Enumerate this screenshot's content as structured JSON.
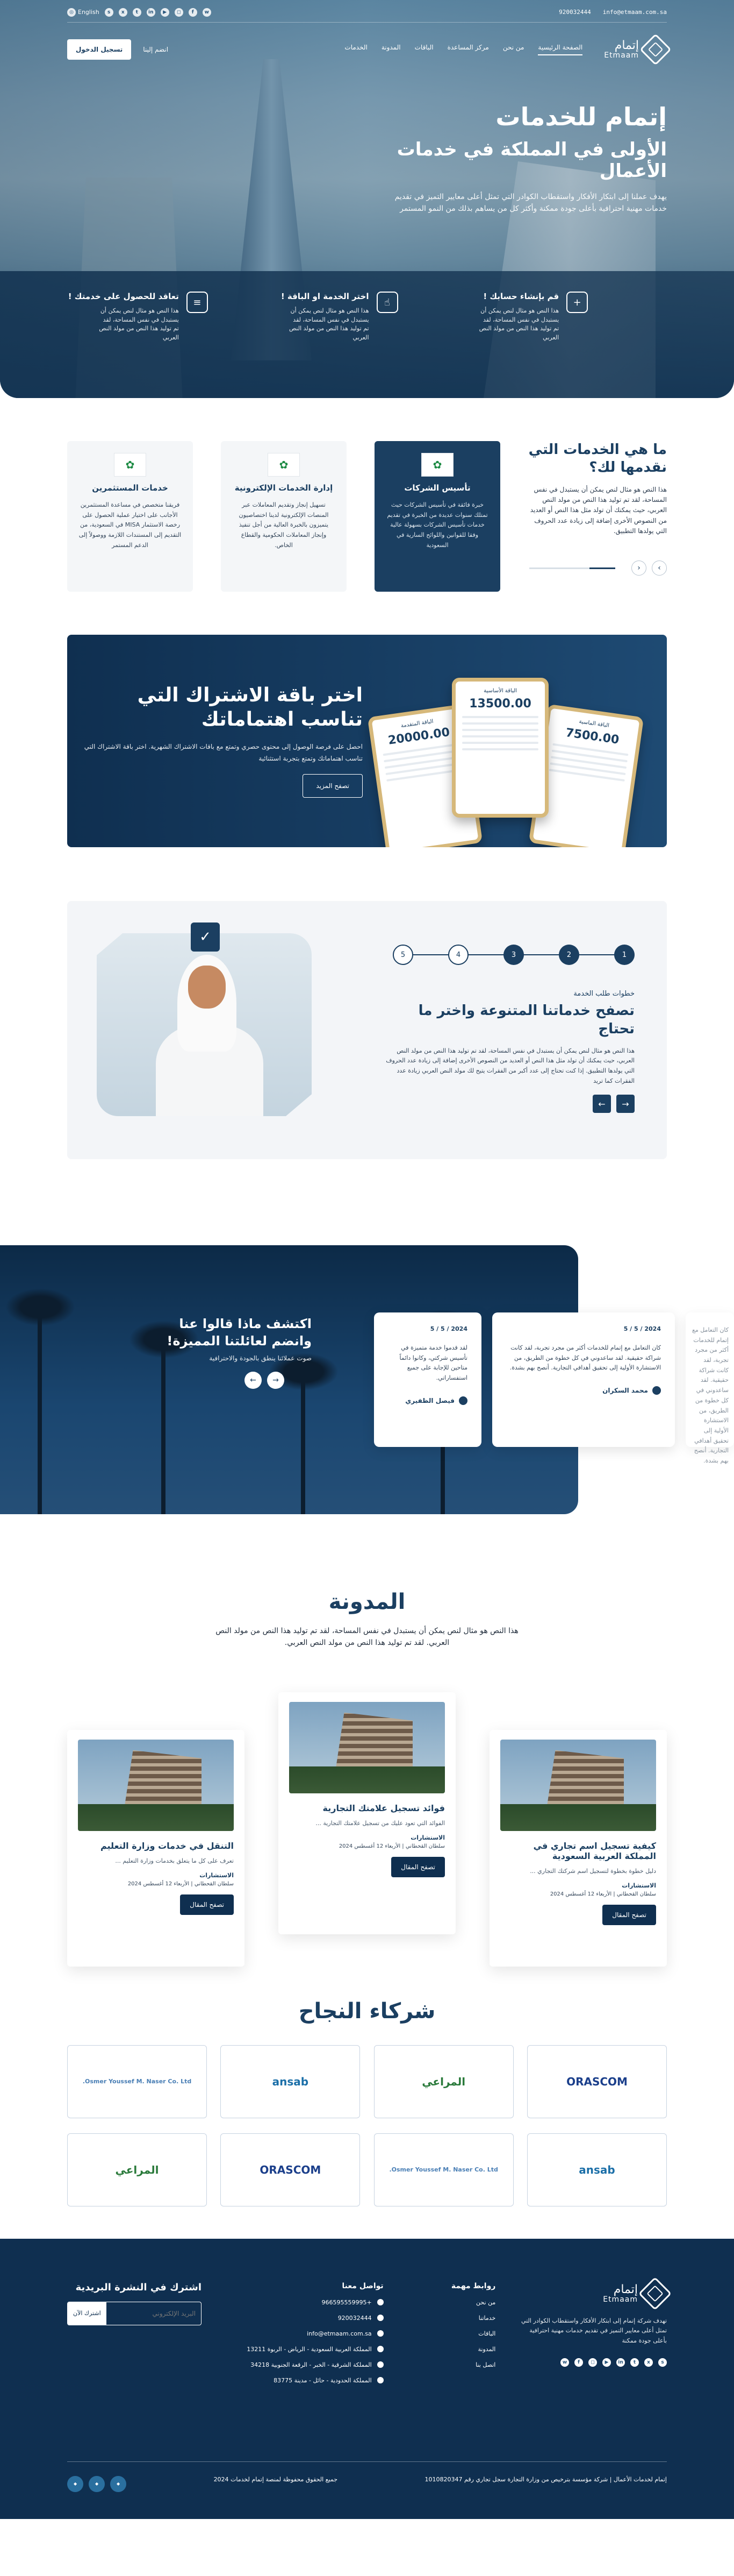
{
  "topbar": {
    "email": "info@etmaam.com.sa",
    "phone": "920032444",
    "language": "English",
    "socials": [
      "snapchat-icon",
      "x-icon",
      "tiktok-icon",
      "linkedin-icon",
      "youtube-icon",
      "instagram-icon",
      "facebook-icon",
      "whatsapp-icon"
    ]
  },
  "brand": {
    "ar": "إتمام",
    "en": "Etmaam"
  },
  "nav": {
    "items": [
      "الصفحة الرئيسية",
      "من نحن",
      "مركز المساعدة",
      "الباقات",
      "المدونة",
      "الخدمات",
      "انضم إلينا"
    ],
    "register": "تسجيل الدخول"
  },
  "hero": {
    "title": "إتمام للخدمات",
    "subtitle": "الأولى في المملكة في خدمات الأعمال",
    "text": "يهدف عملنا إلى ابتكار الأفكار واستقطاب الكوادر التي تمثل أعلى معايير التميز في تقديم خدمات مهنية احترافية بأعلى جودة ممكنة وأكثر كل من يساهم بذلك من النمو المستمر",
    "cards": [
      {
        "title": "قم بإنشاء حسابك !",
        "text": "هذا النص هو مثال لنص يمكن أن يستبدل في نفس المساحة، لقد تم توليد هذا النص من مولد النص العربي"
      },
      {
        "title": "اختر الخدمة او الباقة !",
        "text": "هذا النص هو مثال لنص يمكن أن يستبدل في نفس المساحة، لقد تم توليد هذا النص من مولد النص العربي"
      },
      {
        "title": "تعاقد للحصول على خدمتك !",
        "text": "هذا النص هو مثال لنص يمكن أن يستبدل في نفس المساحة، لقد تم توليد هذا النص من مولد النص العربي"
      }
    ]
  },
  "services": {
    "heading": "ما هي الخدمات التي نقدمها لك؟",
    "text": "هذا النص هو مثال لنص يمكن أن يستبدل في نفس المساحة، لقد تم توليد هذا النص من مولد النص العربي، حيث يمكنك أن تولد مثل هذا النص أو العديد من النصوص الأخرى إضافة إلى زيادة عدد الحروف التي يولدها التطبيق.",
    "cards": [
      {
        "title": "تأسيس الشركات",
        "text": "خبرة فائقة في تأسيس الشركات حيث تمتلك سنوات عديدة من الخبرة في تقديم خدمات تأسيس الشركات بسهولة عالية وفقا للقوانين واللوائح السارية في السعودية"
      },
      {
        "title": "إدارة الخدمات الإلكترونية",
        "text": "تسهيل إنجاز وتقديم المعاملات عبر المنصات الإلكترونية لدينا اختصاصيون يتميزون بالخبرة العالية من أجل تنفيذ وإنجاز المعاملات الحكومية والقطاع الخاص."
      },
      {
        "title": "خدمات المستثمرين",
        "text": "فريقنا متخصص في مساعدة المستثمرين الأجانب على اختيار عملية الحصول على رخصة الاستثمار MISA في السعودية، من التقديم إلى المستندات اللازمة ووصولاً إلى الدعم المستمر"
      }
    ]
  },
  "packages": {
    "heading": "اختر باقة الاشتراك التي تناسب اهتماماتك",
    "text": "احصل على فرصة الوصول إلى محتوى حصري وتمتع مع باقات الاشتراك الشهرية. اختر باقة الاشتراك التي تناسب اهتماماتك وتمتع بتجربة استثنائية",
    "button": "تصفح المزيد",
    "phones": [
      {
        "title": "الباقة الأساسية",
        "price": "13500.00"
      },
      {
        "title": "الباقة المتقدمة",
        "price": "20000.00"
      },
      {
        "title": "الباقة الماسية",
        "price": "7500.00"
      }
    ]
  },
  "steps": {
    "numbers": [
      "1",
      "2",
      "3",
      "4",
      "5"
    ],
    "kicker": "خطوات طلب الخدمة",
    "heading": "تصفح خدماتنا المتنوعة واختر ما تحتاج",
    "text": "هذا النص هو مثال لنص يمكن أن يستبدل في نفس المساحة، لقد تم توليد هذا النص من مولد النص العربي، حيث يمكنك أن تولد مثل هذا النص أو العديد من النصوص الأخرى إضافة إلى زيادة عدد الحروف التي يولدها التطبيق. إذا كنت تحتاج إلى عدد أكبر من الفقرات يتيح لك مولد النص العربي زيادة عدد الفقرات كما تريد"
  },
  "testimonials": {
    "heading": "اكتشف ماذا قالوا عنا وانضم لعائلتنا المميزة!",
    "sub": "صوت عملائنا ينطق بالجودة والاحترافية",
    "cards": [
      {
        "date": "2024 / 5 / 5",
        "text": "كان التعامل مع إتمام للخدمات أكثر من مجرد تجربة، لقد كانت شراكة حقيقية. لقد ساعدوني في كل خطوة من الطريق، من الاستشارة الأولية إلى تحقيق أهدافي التجارية. أنصح بهم بشدة.",
        "name": "محمد السكران"
      },
      {
        "date": "2024 / 5 / 5",
        "text": "لقد قدموا خدمة متميزة في تأسيس شركتي، وكانوا دائماً متاحين للإجابة على جميع استفساراتي.",
        "name": "فيصل الظفيري"
      }
    ]
  },
  "blog": {
    "heading": "المدونة",
    "sub": "هذا النص هو مثال لنص يمكن أن يستبدل في نفس المساحة، لقد تم توليد هذا النص من مولد النص العربي. لقد تم توليد هذا النص من مولد النص العربي.",
    "cards": [
      {
        "title": "كيفية تسجيل اسم تجاري في المملكة العربية السعودية",
        "excerpt": "دليل خطوة بخطوة لتسجيل اسم شركتك التجاري ...",
        "author": "الاستشارات",
        "meta": "سلطان القحطاني | الأربعاء 12 أغسطس 2024",
        "button": "تصفح المقال"
      },
      {
        "title": "فوائد تسجيل علامتك التجارية",
        "excerpt": "الفوائد التي تعود عليك من تسجيل علامتك التجارية ...",
        "author": "الاستشارات",
        "meta": "سلطان القحطاني | الأربعاء 12 أغسطس 2024",
        "button": "تصفح المقال"
      },
      {
        "title": "التنقل في خدمات وزارة التعليم",
        "excerpt": "تعرف على كل ما يتعلق بخدمات وزارة التعليم ...",
        "author": "الاستشارات",
        "meta": "سلطان القحطاني | الأربعاء 12 أغسطس 2024",
        "button": "تصفح المقال"
      }
    ]
  },
  "partners": {
    "heading": "شركاء النجاح",
    "logos": [
      {
        "name": "ORASCOM",
        "color": "#1b3f8b"
      },
      {
        "name": "المراعي",
        "color": "#2a7a3b"
      },
      {
        "name": "ansab",
        "color": "#1b6fa8"
      },
      {
        "name": "Osmer Youssef M. Naser Co. Ltd.",
        "color": "#4a7fb5"
      },
      {
        "name": "ansab",
        "color": "#1b6fa8"
      },
      {
        "name": "Osmer Youssef M. Naser Co. Ltd.",
        "color": "#4a7fb5"
      },
      {
        "name": "ORASCOM",
        "color": "#1b3f8b"
      },
      {
        "name": "المراعي",
        "color": "#2a7a3b"
      }
    ]
  },
  "footer": {
    "about": "تهدف شركة إتمام إلى ابتكار الأفكار واستقطاب الكوادر التي تمثل أعلى معايير التميز في تقديم خدمات مهنية احترافية بأعلى جودة ممكنة",
    "links_title": "روابط مهمة",
    "links": [
      "من نحن",
      "خدماتنا",
      "الباقات",
      "المدونة",
      "اتصل بنا"
    ],
    "contact_title": "تواصل معنا",
    "contact": [
      "+966595559995",
      "920032444",
      "info@etmaam.com.sa",
      "المملكة العربية السعودية - الرياض - الربوة 13211",
      "المملكة الشرقية - الخبر - الرقعة الجنوبية 34218",
      "المملكة الحدودية - حائل - مدينة 83775"
    ],
    "newsletter_title": "اشترك في النشرة البريدية",
    "newsletter_placeholder": "البريد الإلكتروني",
    "newsletter_button": "اشترك الآن",
    "license": "إتمام لخدمات الأعمال | شركة مؤسسة بترخيص من وزارة التجارة سجل تجاري رقم 1010820347",
    "copyright": "جميع الحقوق محفوظة لمنصة إتمام لخدمات 2024"
  }
}
